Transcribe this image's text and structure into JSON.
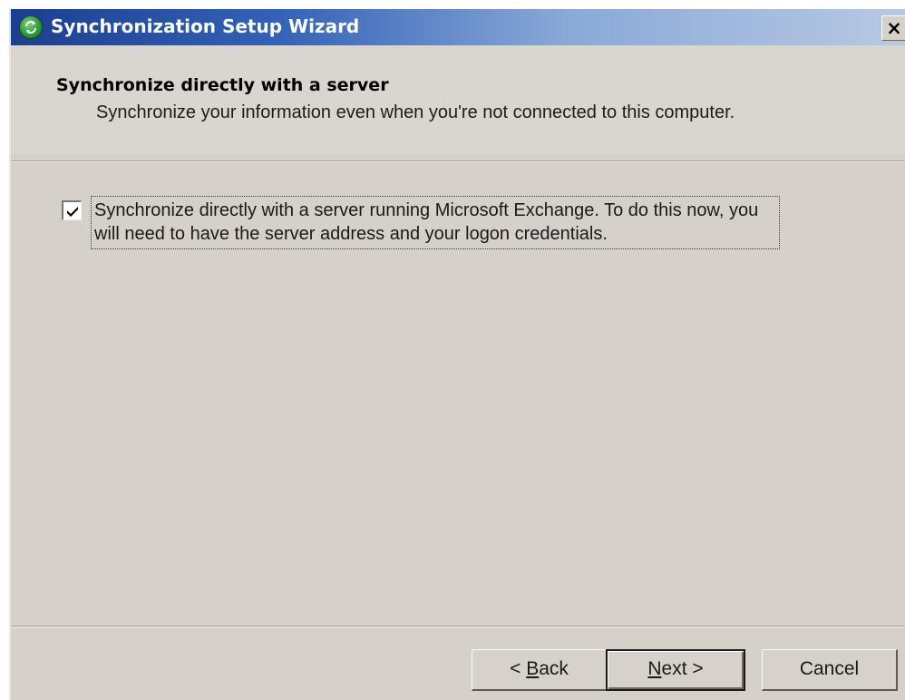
{
  "window": {
    "title": "Synchronization Setup Wizard",
    "close_label": "×",
    "app_icon": "sync-icon"
  },
  "header": {
    "title": "Synchronize directly with a server",
    "subtitle": "Synchronize your information even when you're not connected to this computer."
  },
  "option": {
    "checked": true,
    "label": "Synchronize directly with a server running Microsoft Exchange.  To do this now, you will need to have the server address and your logon credentials."
  },
  "buttons": {
    "back_prefix": "< ",
    "back_mnemonic": "B",
    "back_rest": "ack",
    "next_mnemonic": "N",
    "next_rest": "ext >",
    "cancel_label": "Cancel"
  },
  "colors": {
    "titlebar_start": "#1c3f8f",
    "titlebar_end": "#b7c9e3",
    "dialog_bg": "#d5d0c9"
  }
}
